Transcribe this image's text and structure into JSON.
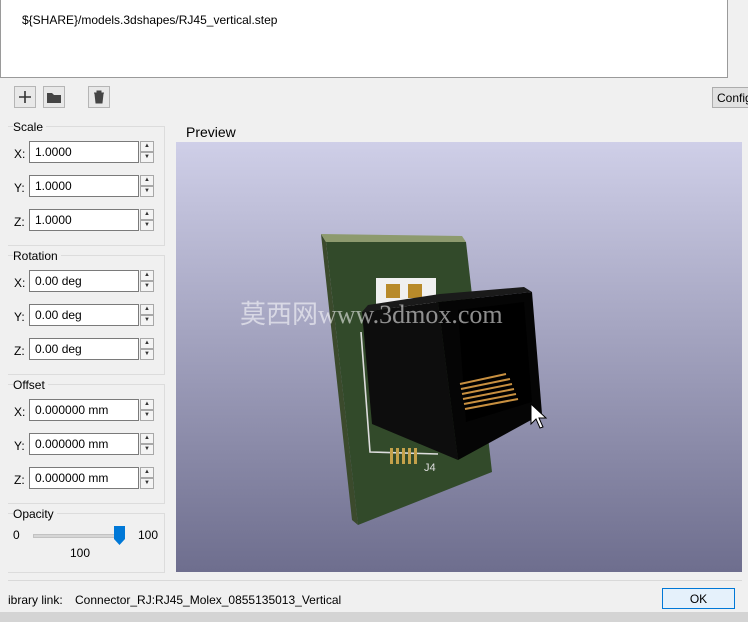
{
  "file_list": {
    "rows": [
      "${SHARE}/models.3dshapes/RJ45_vertical.step"
    ]
  },
  "toolbar": {
    "add_icon": "plus-icon",
    "folder_icon": "folder-icon",
    "delete_icon": "trash-icon",
    "config_label": "Config"
  },
  "scale": {
    "title": "Scale",
    "x_label": "X:",
    "y_label": "Y:",
    "z_label": "Z:",
    "x": "1.0000",
    "y": "1.0000",
    "z": "1.0000"
  },
  "rotation": {
    "title": "Rotation",
    "x_label": "X:",
    "y_label": "Y:",
    "z_label": "Z:",
    "x": "0.00 deg",
    "y": "0.00 deg",
    "z": "0.00 deg"
  },
  "offset": {
    "title": "Offset",
    "x_label": "X:",
    "y_label": "Y:",
    "z_label": "Z:",
    "x": "0.000000 mm",
    "y": "0.000000 mm",
    "z": "0.000000 mm"
  },
  "opacity": {
    "title": "Opacity",
    "min": "0",
    "max": "100",
    "value_label": "100",
    "value": 1.0
  },
  "preview": {
    "title": "Preview",
    "ref_label": "J4"
  },
  "watermark": "莫西网www.3dmox.com",
  "footer": {
    "library_label": "ibrary link:",
    "library_value": "Connector_RJ:RJ45_Molex_0855135013_Vertical",
    "ok_label": "OK"
  }
}
